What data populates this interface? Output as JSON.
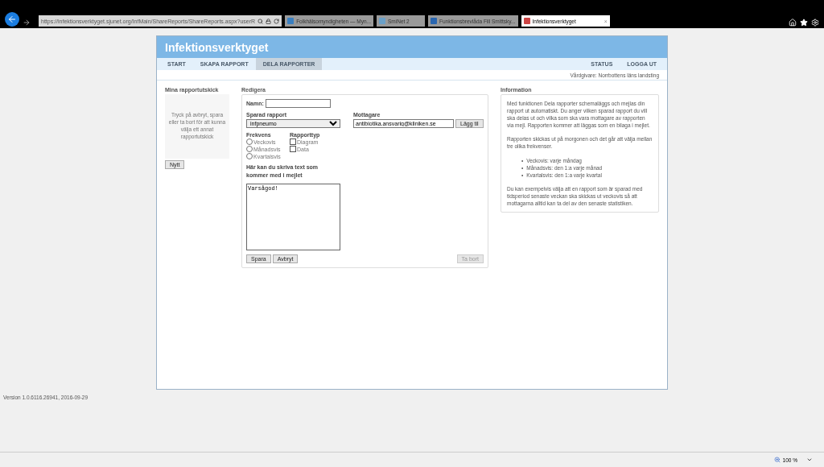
{
  "browser": {
    "url": "https://infektionsverktyget.sjunet.org/InfMain/ShareReports/ShareReports.aspx?userR",
    "tabs": [
      {
        "label": "Folkhälsomyndigheten — Myn...",
        "selected": false
      },
      {
        "label": "SmiNet 2",
        "selected": false
      },
      {
        "label": "Funktionsbrevlåda Fill Smittsky...",
        "selected": false
      },
      {
        "label": "Infektionsverktyget",
        "selected": true,
        "close": "×"
      }
    ]
  },
  "app": {
    "title": "Infektionsverktyget",
    "nav_left": [
      {
        "label": "START",
        "selected": false
      },
      {
        "label": "SKAPA RAPPORT",
        "selected": false
      },
      {
        "label": "DELA RAPPORTER",
        "selected": true
      }
    ],
    "nav_right": [
      {
        "label": "STATUS"
      },
      {
        "label": "LOGGA UT"
      }
    ],
    "care_provider": "Vårdgivare: Norrbottens läns landsting"
  },
  "my_sends": {
    "title": "Mina rapportutskick",
    "hint": "Tryck på avbryt, spara eller ta bort för att kunna välja ett annat rapportutskick",
    "new_button": "Nytt"
  },
  "edit": {
    "title": "Redigera",
    "name_label": "Namn:",
    "saved_report_label": "Sparad rapport",
    "saved_report_value": "infpneumo",
    "recipient_label": "Mottagare",
    "recipient_value": "antibiotika.ansvarig@kliniken.se",
    "add_button": "Lägg til",
    "frequency_label": "Frekvens",
    "frequency_options": [
      {
        "label": "Veckovis",
        "selected": false
      },
      {
        "label": "Månadsvis",
        "selected": false
      },
      {
        "label": "Kvartalsvis",
        "selected": false
      }
    ],
    "report_type_label": "Rapporttyp",
    "report_types": [
      {
        "label": "Diagram",
        "checked": false
      },
      {
        "label": "Data",
        "checked": false
      }
    ],
    "message_label": "Här kan du skriva text som kommer med i mejlet",
    "message_value": "Varsågod!",
    "save_button": "Spara",
    "cancel_button": "Avbryt",
    "delete_button": {
      "label": "Ta bort",
      "disabled": true
    }
  },
  "information": {
    "title": "Information",
    "paragraphs": [
      "Med funktionen Dela rapporter schemaläggs och mejlas din rapport ut automatiskt. Du anger vilken sparad rapport du vill ska delas ut och vilka som ska vara mottagare av rapporten via mejl. Rapporten kommer att läggas som en bilaga i mejlet.",
      "Rapporten skickas ut på morgonen och det går att välja mellan tre olika frekvenser."
    ],
    "bullet": "•",
    "list": [
      "Veckovis: varje måndag",
      "Månadsvis: den 1:a varje månad",
      "Kvartalsvis: den 1:a varje kvartal"
    ],
    "closing": "Du kan exempelvis välja att en rapport som är sparad med tidsperiod senaste veckan ska skickas ut veckovis så att mottagarna alltid kan ta del av den senaste statistiken."
  },
  "version": "Version 1.0.6116.26941, 2016-09-29",
  "status_bar": {
    "zoom": "100 %"
  }
}
